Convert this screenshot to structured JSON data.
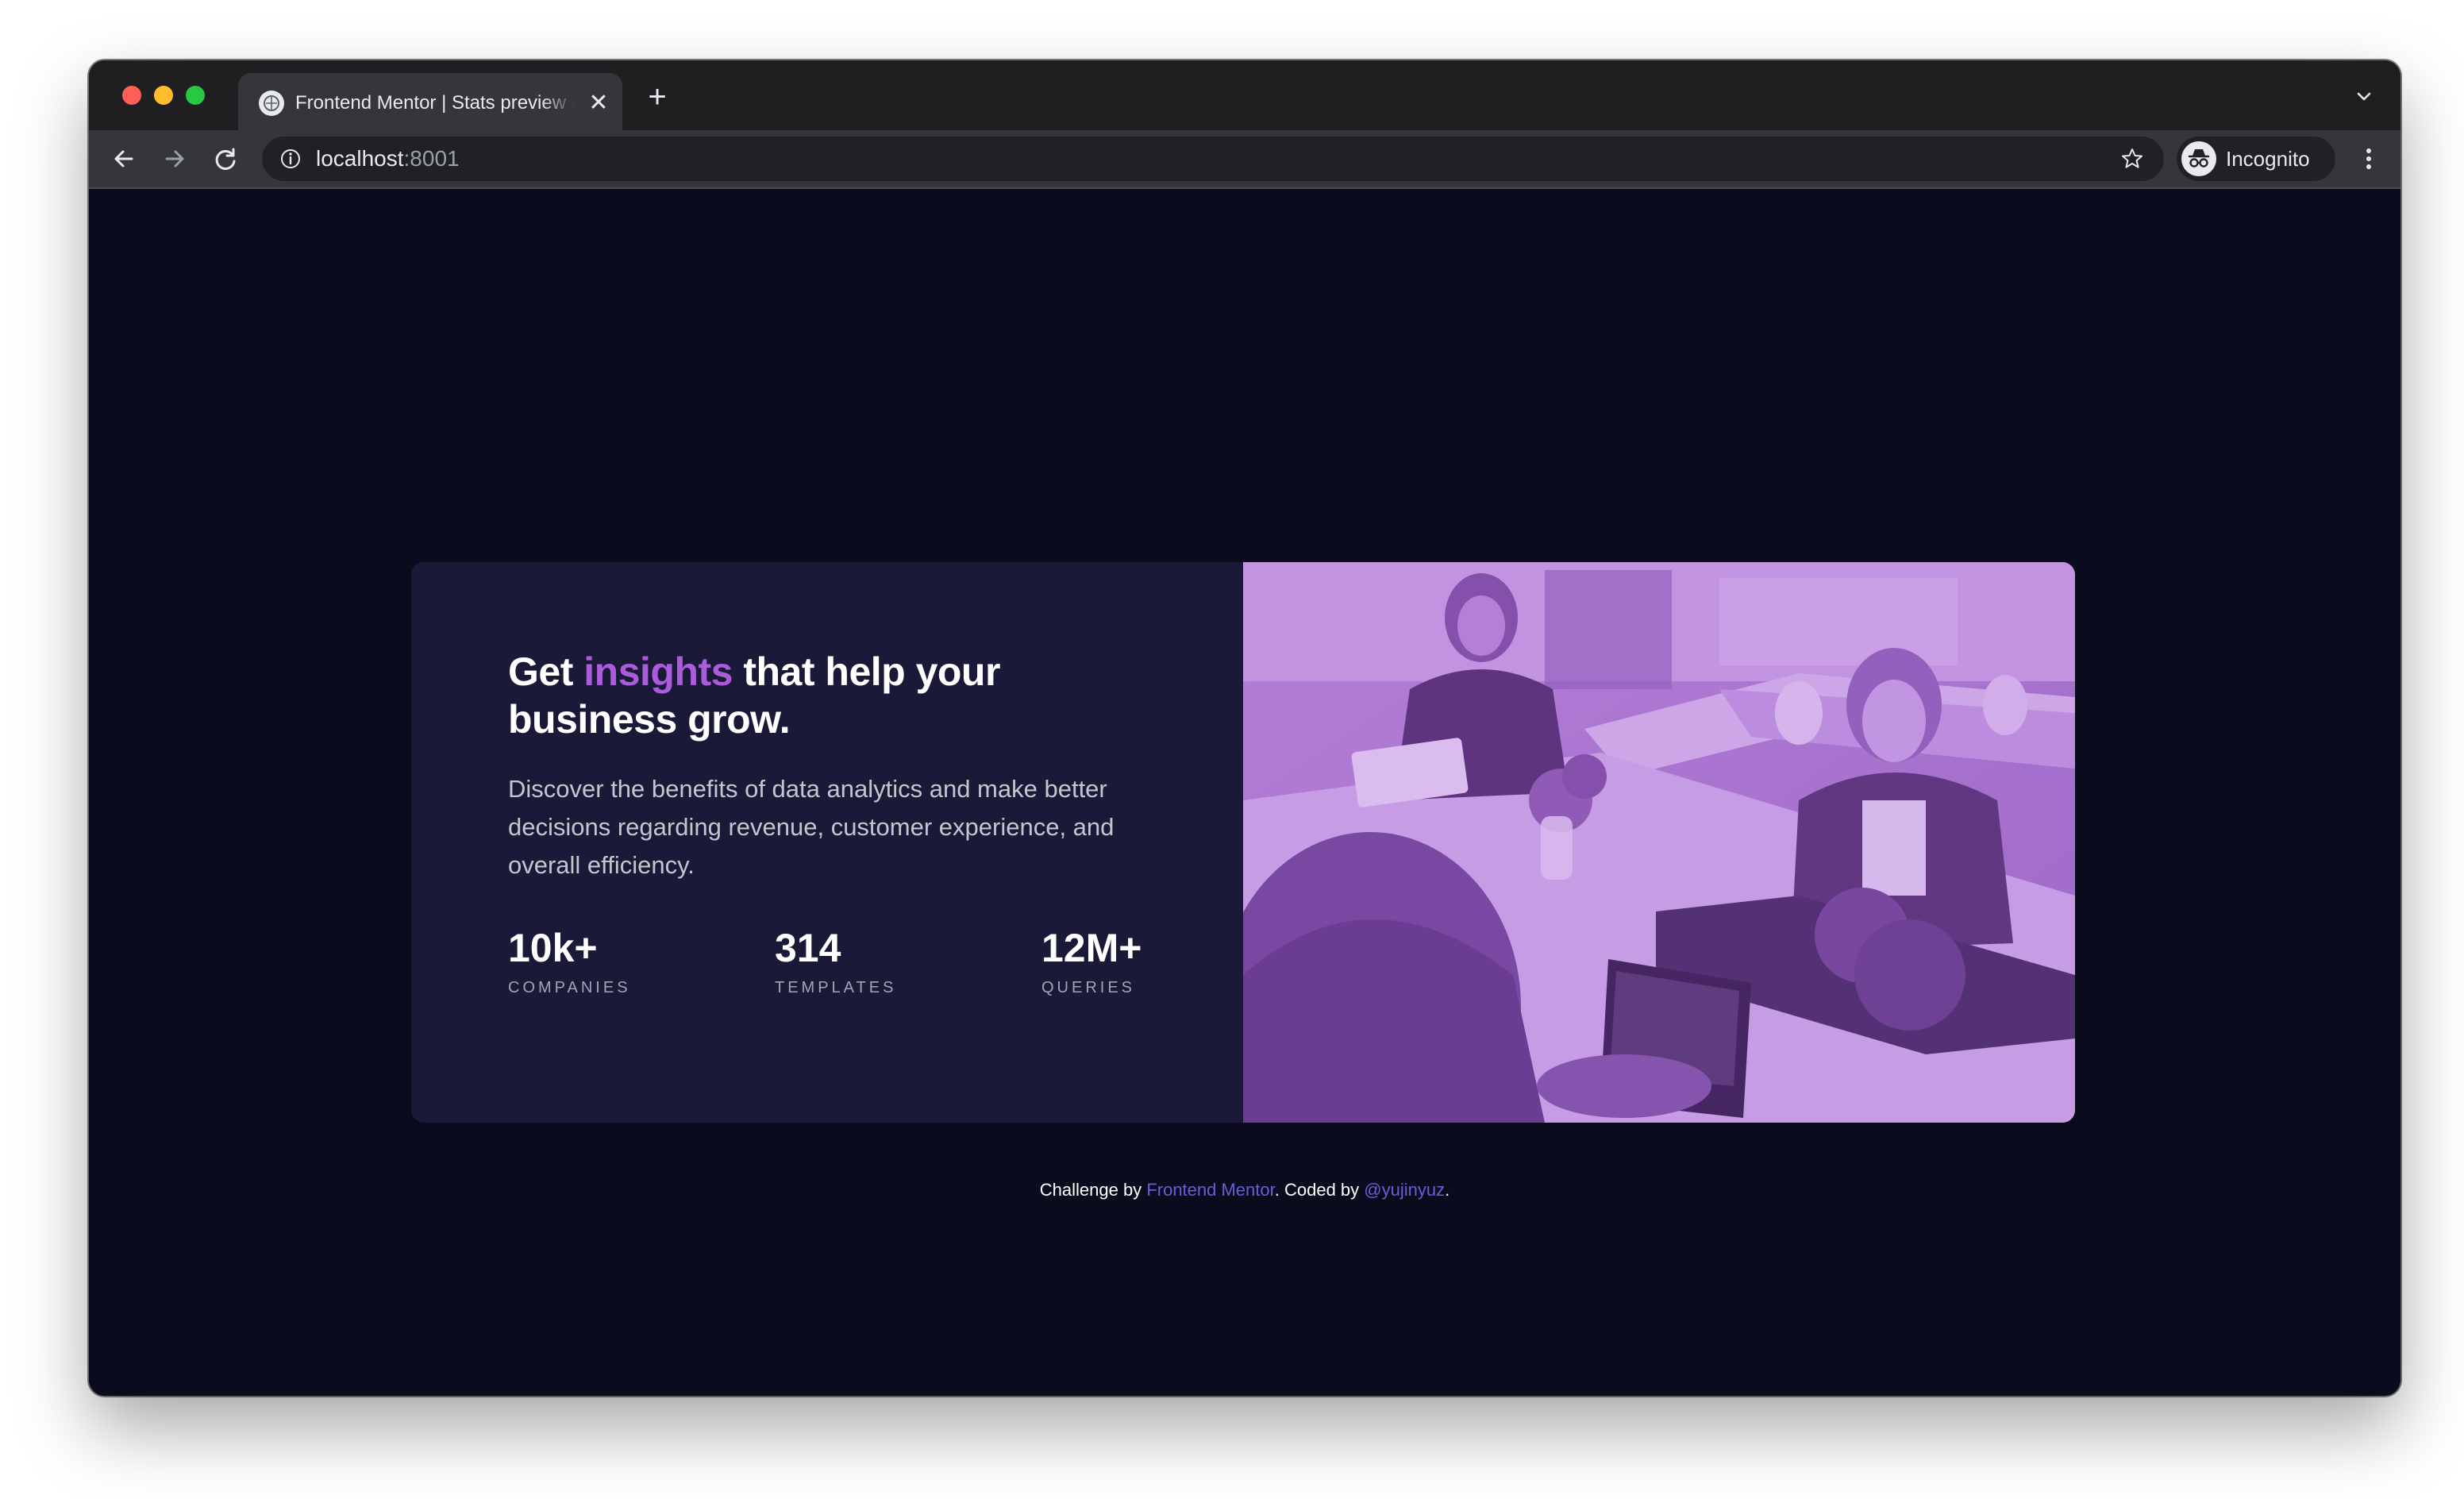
{
  "browser": {
    "tab": {
      "title": "Frontend Mentor | Stats preview card component",
      "close_glyph": "✕"
    },
    "new_tab_glyph": "+",
    "url": {
      "host": "localhost",
      "port": ":8001"
    },
    "profile_label": "Incognito",
    "icons": {
      "back": "arrow-left-icon",
      "forward": "arrow-right-icon",
      "reload": "reload-icon",
      "site_info": "info-icon",
      "bookmark": "star-icon",
      "menu": "kebab-icon",
      "tab_list": "chevron-down-icon"
    }
  },
  "card": {
    "heading_before": "Get",
    "heading_accent": "insights",
    "heading_after": "that help your business grow.",
    "description": "Discover the benefits of data analytics and make better decisions regarding revenue, customer experience, and overall efficiency.",
    "stats": [
      {
        "value": "10k+",
        "label": "COMPANIES"
      },
      {
        "value": "314",
        "label": "TEMPLATES"
      },
      {
        "value": "12M+",
        "label": "QUERIES"
      }
    ]
  },
  "attribution": {
    "prefix": "Challenge by",
    "link1": "Frontend Mentor",
    "middle": ". Coded by",
    "link2": "@yujinyuz",
    "suffix": "."
  },
  "colors": {
    "page_bg": "#0a0c1d",
    "card_bg": "#1b1938",
    "accent": "#aa5cdb",
    "link": "#6360d9",
    "image_tint": "#aa5cdb"
  }
}
